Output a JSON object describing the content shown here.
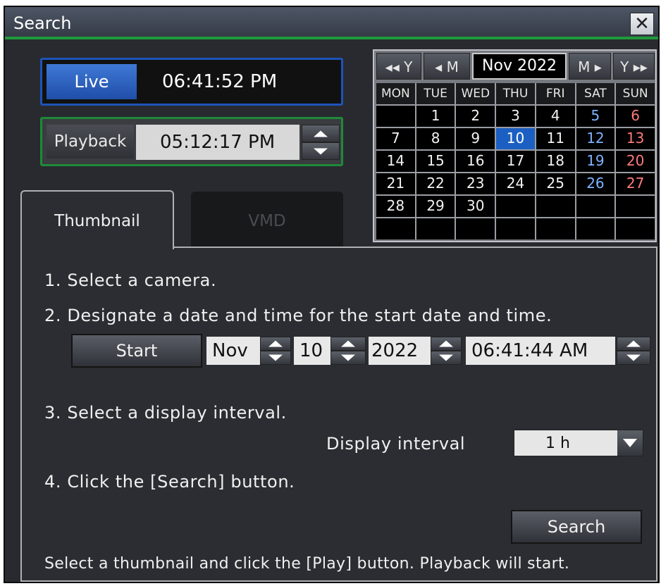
{
  "window": {
    "title": "Search",
    "close_label": "✕"
  },
  "live": {
    "button_label": "Live",
    "time": "06:41:52 PM"
  },
  "playback": {
    "button_label": "Playback",
    "time": "05:12:17 PM"
  },
  "calendar": {
    "nav": {
      "prev_year": "◂◂ Y",
      "prev_month": "◂ M",
      "month_label": "Nov 2022",
      "next_month": "M ▸",
      "next_year": "Y ▸▸"
    },
    "weekdays": [
      "MON",
      "TUE",
      "WED",
      "THU",
      "FRI",
      "SAT",
      "SUN"
    ],
    "selected_day": "10",
    "weeks": [
      [
        "",
        "1",
        "2",
        "3",
        "4",
        "5",
        "6"
      ],
      [
        "7",
        "8",
        "9",
        "10",
        "11",
        "12",
        "13"
      ],
      [
        "14",
        "15",
        "16",
        "17",
        "18",
        "19",
        "20"
      ],
      [
        "21",
        "22",
        "23",
        "24",
        "25",
        "26",
        "27"
      ],
      [
        "28",
        "29",
        "30",
        "",
        "",
        "",
        ""
      ],
      [
        "",
        "",
        "",
        "",
        "",
        "",
        ""
      ]
    ]
  },
  "tabs": {
    "thumbnail": "Thumbnail",
    "vmd": "VMD"
  },
  "steps": {
    "s1": "1. Select a camera.",
    "s2": "2. Designate a date and time for the start date and time.",
    "s3": "3. Select a display interval.",
    "s4": "4. Click the [Search] button."
  },
  "start": {
    "button_label": "Start",
    "month": "Nov",
    "day": "10",
    "year": "2022",
    "time": "06:41:44 AM"
  },
  "interval": {
    "label": "Display interval",
    "value": "1 h"
  },
  "search_button": "Search",
  "footer": "Select a thumbnail and click the [Play] button. Playback will start."
}
